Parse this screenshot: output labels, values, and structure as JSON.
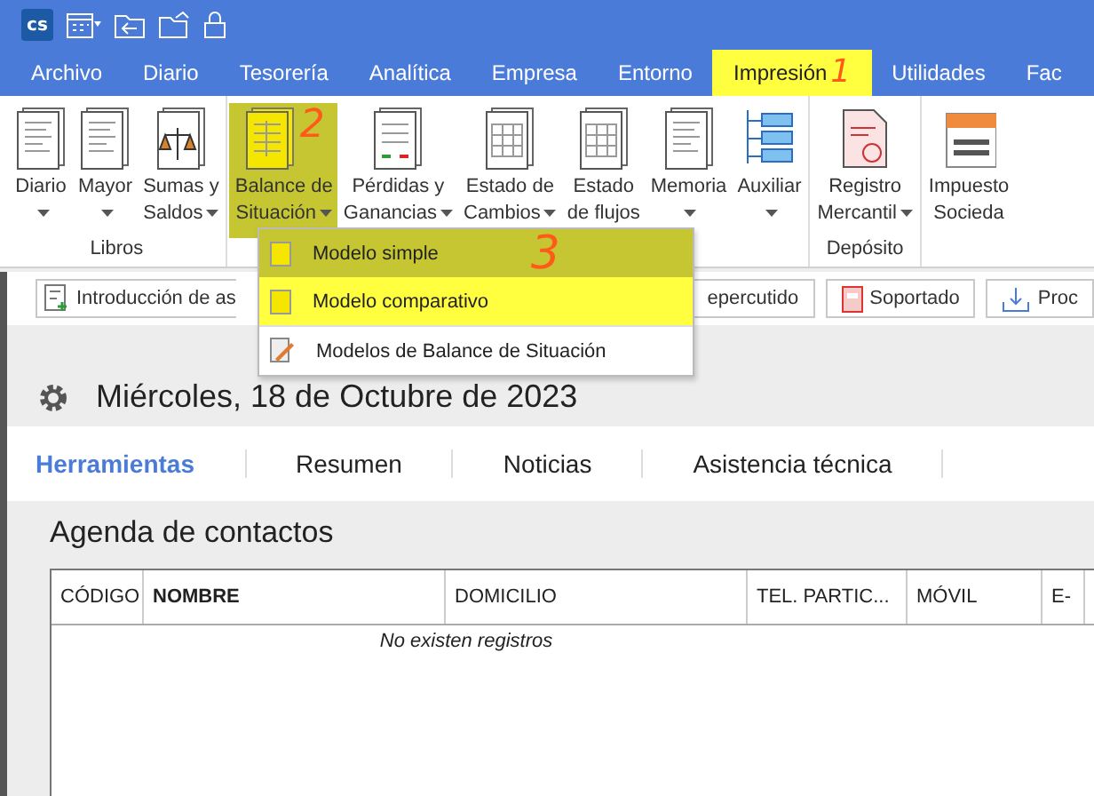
{
  "title_bar": {
    "logo": "cs"
  },
  "menu_tabs": [
    {
      "label": "Archivo",
      "selected": false,
      "highlighted": false
    },
    {
      "label": "Diario",
      "selected": false,
      "highlighted": false
    },
    {
      "label": "Tesorería",
      "selected": false,
      "highlighted": false
    },
    {
      "label": "Analítica",
      "selected": false,
      "highlighted": false
    },
    {
      "label": "Empresa",
      "selected": false,
      "highlighted": false
    },
    {
      "label": "Entorno",
      "selected": false,
      "highlighted": false
    },
    {
      "label": "Impresión",
      "selected": true,
      "highlighted": true,
      "annotation": "1"
    },
    {
      "label": "Utilidades",
      "selected": false,
      "highlighted": false
    },
    {
      "label": "Fac",
      "selected": false,
      "highlighted": false
    }
  ],
  "ribbon": {
    "groups": [
      {
        "label": "Libros",
        "items": [
          {
            "lines": [
              "Diario"
            ],
            "kind": "document",
            "dropdown": true,
            "selected": false,
            "highlighted": false
          },
          {
            "lines": [
              "Mayor"
            ],
            "kind": "document",
            "dropdown": true,
            "selected": false,
            "highlighted": false
          },
          {
            "lines": [
              "Sumas y",
              "Saldos"
            ],
            "kind": "scales",
            "dropdown": true,
            "selected": false,
            "highlighted": false
          }
        ]
      },
      {
        "items": [
          {
            "lines": [
              "Balance de",
              "Situación"
            ],
            "kind": "balance",
            "dropdown": true,
            "selected": true,
            "highlighted": true,
            "annotation": "2"
          },
          {
            "lines": [
              "Pérdidas y",
              "Ganancias"
            ],
            "kind": "ledger",
            "dropdown": true,
            "selected": false,
            "highlighted": false
          },
          {
            "lines": [
              "Estado de",
              "Cambios"
            ],
            "kind": "table",
            "dropdown": true,
            "selected": false,
            "highlighted": false
          },
          {
            "lines": [
              "Estado",
              "de flujos"
            ],
            "kind": "table",
            "dropdown": false,
            "selected": false,
            "highlighted": false
          },
          {
            "lines": [
              "Memoria"
            ],
            "kind": "document",
            "dropdown": true,
            "selected": false,
            "highlighted": false
          },
          {
            "lines": [
              "Auxiliar"
            ],
            "kind": "tree",
            "dropdown": true,
            "selected": false,
            "highlighted": false
          }
        ]
      },
      {
        "label": "Depósito",
        "items": [
          {
            "lines": [
              "Registro",
              "Mercantil"
            ],
            "kind": "register",
            "dropdown": true,
            "selected": false,
            "highlighted": false
          }
        ]
      },
      {
        "items": [
          {
            "lines": [
              "Impuesto",
              "Socieda"
            ],
            "kind": "tax",
            "dropdown": false,
            "selected": false,
            "highlighted": false
          }
        ]
      }
    ]
  },
  "dropdown_menu": {
    "items": [
      {
        "label": "Modelo simple",
        "kind": "model",
        "selected": true,
        "highlighted": true,
        "annotation": "3"
      },
      {
        "label": "Modelo comparativo",
        "kind": "model",
        "selected": false,
        "highlighted": true
      },
      {
        "label": "Modelos de Balance de Situación",
        "kind": "settings",
        "selected": false,
        "highlighted": false
      }
    ]
  },
  "toolbar_buttons": [
    {
      "label": "Introducción de as",
      "kind": "entry"
    },
    {
      "label": "epercutido",
      "kind": "plain"
    },
    {
      "label": "Soportado",
      "kind": "book"
    },
    {
      "label": "Proc",
      "kind": "process"
    }
  ],
  "date": "Miércoles, 18 de Octubre de 2023",
  "home_tabs": [
    {
      "label": "Herramientas",
      "selected": true
    },
    {
      "label": "Resumen",
      "selected": false
    },
    {
      "label": "Noticias",
      "selected": false
    },
    {
      "label": "Asistencia técnica",
      "selected": false
    }
  ],
  "contacts": {
    "title": "Agenda de contactos",
    "columns": [
      {
        "label": "CÓDIGO",
        "sorted": false
      },
      {
        "label": "NOMBRE",
        "sorted": true
      },
      {
        "label": "DOMICILIO",
        "sorted": false
      },
      {
        "label": "TEL. PARTIC...",
        "sorted": false
      },
      {
        "label": "MÓVIL",
        "sorted": false
      },
      {
        "label": "E-",
        "sorted": false
      }
    ],
    "empty_message": "No existen registros"
  }
}
